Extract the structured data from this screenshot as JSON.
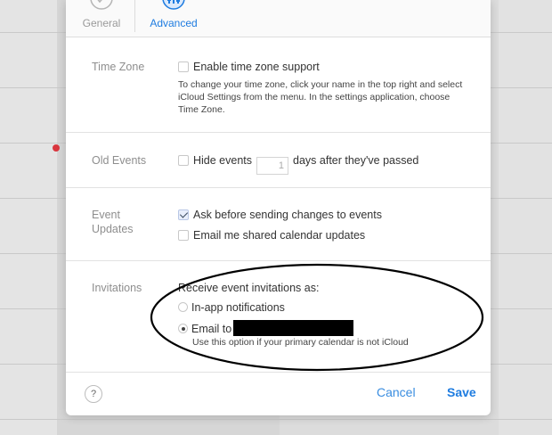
{
  "tabs": [
    {
      "label": "General",
      "icon": "checkmark-circle-icon",
      "selected": false
    },
    {
      "label": "Advanced",
      "icon": "advanced-gear-icon",
      "selected": true
    }
  ],
  "time_zone": {
    "label": "Time Zone",
    "checkbox_label": "Enable time zone support",
    "checked": false,
    "description": "To change your time zone, click your name in the top right and select iCloud Settings from the menu. In the settings application, choose Time Zone."
  },
  "old_events": {
    "label": "Old Events",
    "prefix": "Hide events",
    "days_value": "1",
    "suffix": "days after they've passed",
    "checked": false
  },
  "event_updates": {
    "label_line1": "Event",
    "label_line2": "Updates",
    "options": [
      {
        "label": "Ask before sending changes to events",
        "checked": true
      },
      {
        "label": "Email me shared calendar updates",
        "checked": false
      }
    ]
  },
  "invitations": {
    "label": "Invitations",
    "heading": "Receive event invitations as:",
    "option_inapp": "In-app notifications",
    "option_email": "Email to",
    "email_hint": "Use this option if your primary calendar is not iCloud"
  },
  "footer": {
    "help": "?",
    "cancel": "Cancel",
    "save": "Save"
  },
  "colors": {
    "accent": "#1e7ce0",
    "annotation": "#000000"
  }
}
